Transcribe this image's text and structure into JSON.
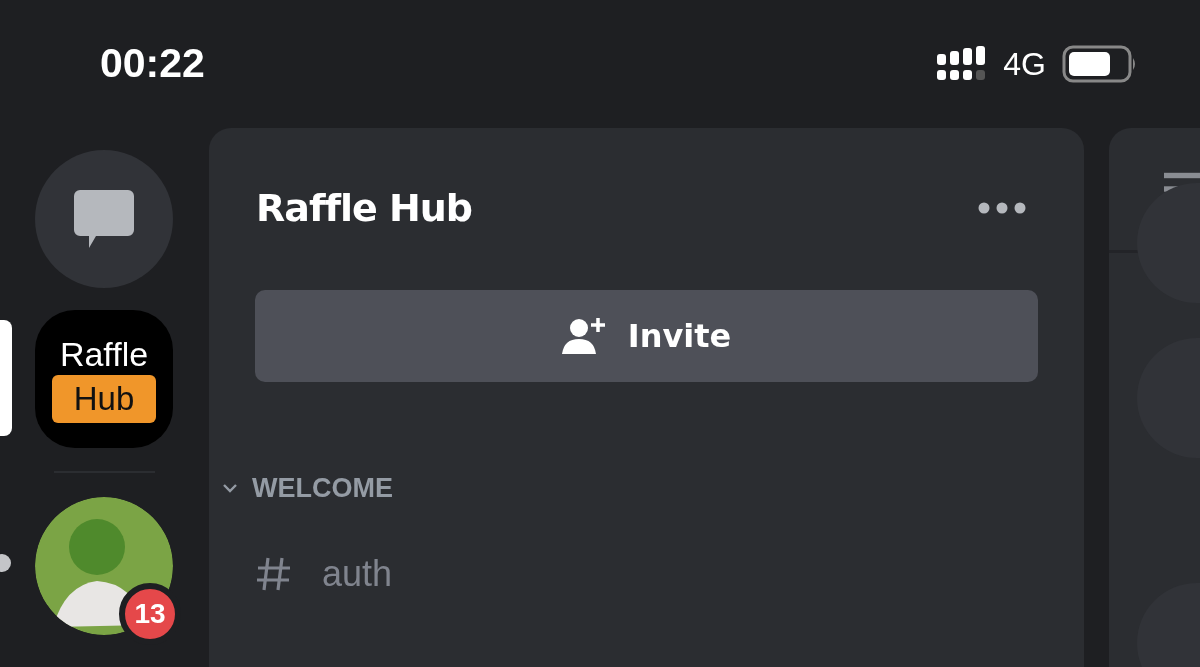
{
  "status_bar": {
    "time": "00:22",
    "network": "4G"
  },
  "servers": [
    {
      "kind": "dm",
      "selected": false
    },
    {
      "kind": "logo",
      "line1": "Raffle",
      "line2": "Hub",
      "selected": true
    },
    {
      "kind": "avatar",
      "selected": false,
      "unread": true,
      "badge": "13"
    }
  ],
  "channel_panel": {
    "title": "Raffle Hub",
    "invite_label": "Invite",
    "categories": [
      {
        "name": "WELCOME",
        "expanded": true,
        "channels": [
          {
            "name": "auth",
            "selected": false
          }
        ]
      }
    ]
  }
}
